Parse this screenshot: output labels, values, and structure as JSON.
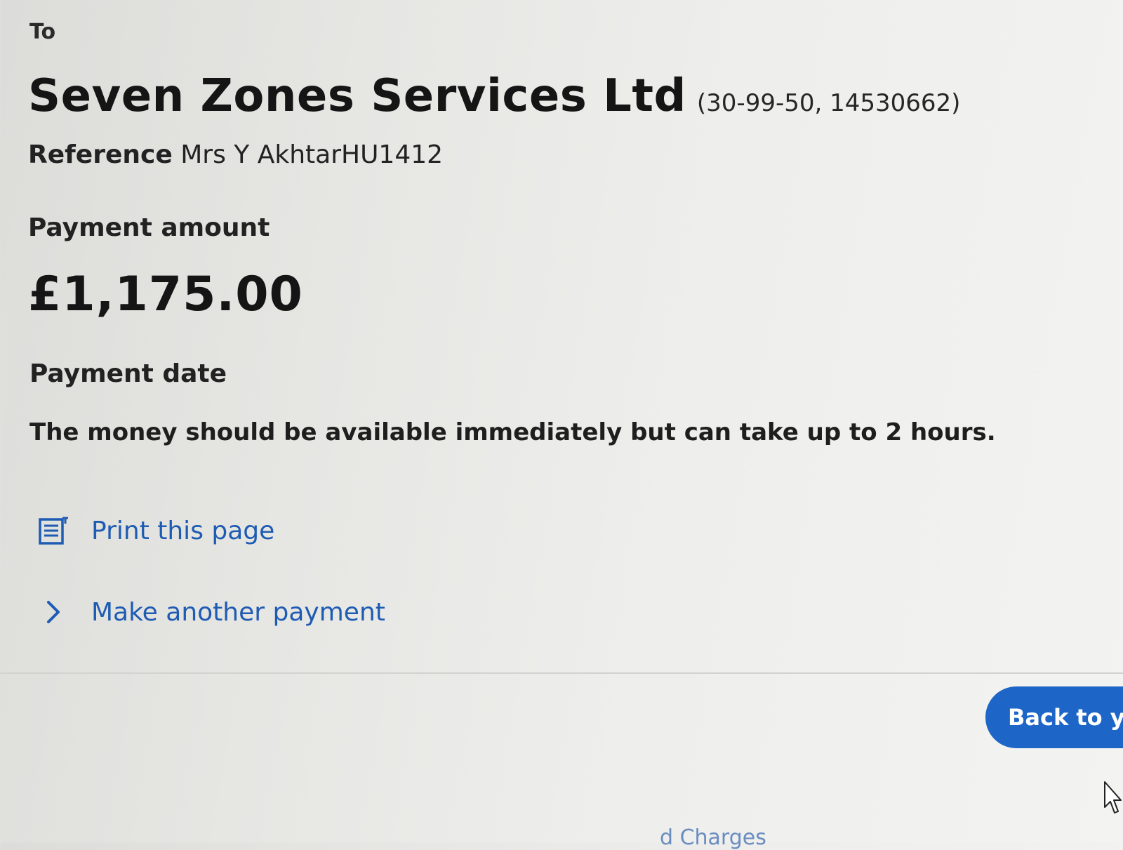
{
  "confirmation": {
    "to_label": "To",
    "payee_name": "Seven Zones Services Ltd",
    "payee_account": "(30-99-50, 14530662)",
    "reference_label": "Reference",
    "reference_value": "Mrs Y AkhtarHU1412",
    "amount_label": "Payment amount",
    "amount_value": "£1,175.00",
    "date_label": "Payment date",
    "date_value": "The money should be available immediately but can take up to 2 hours."
  },
  "actions": {
    "print_label": "Print this page",
    "print_icon": "document-icon",
    "another_payment_label": "Make another payment",
    "another_payment_icon": "chevron-right-icon"
  },
  "footer": {
    "back_button_label": "Back to yo",
    "partial_link_text": "d Charges"
  },
  "colors": {
    "link": "#1e5bb3",
    "button": "#1d66c8"
  }
}
